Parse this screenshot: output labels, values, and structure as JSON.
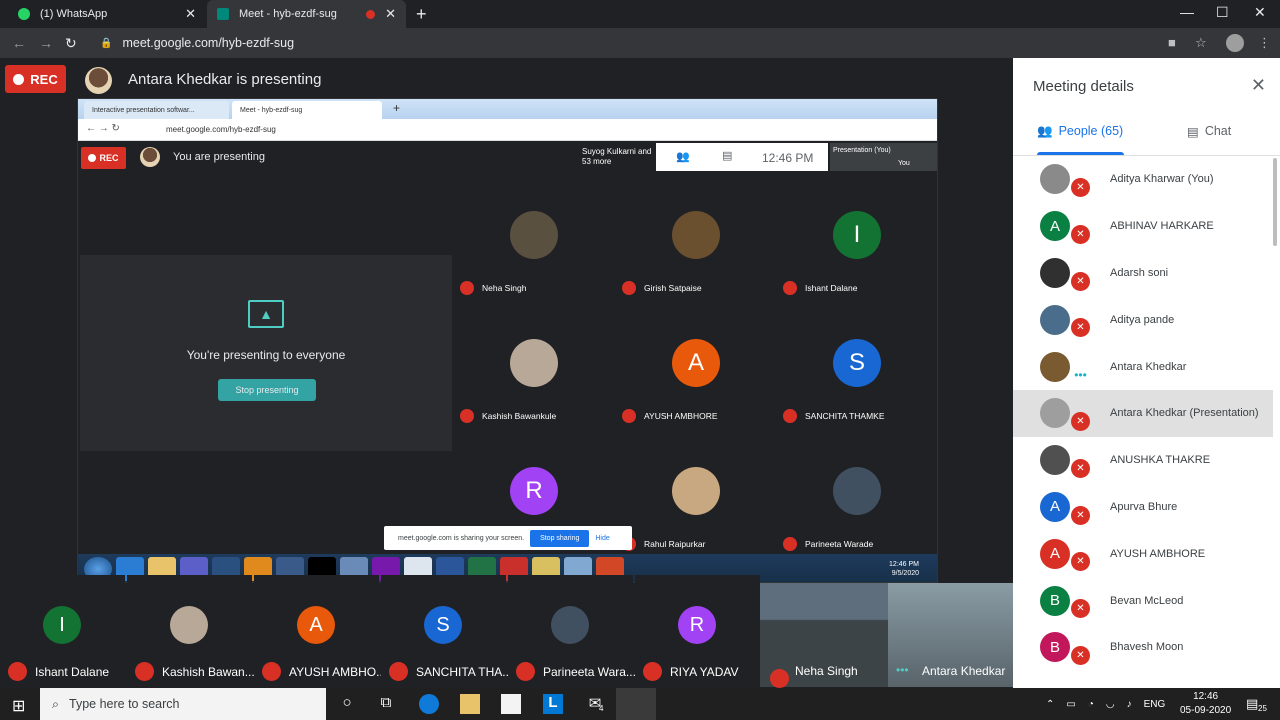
{
  "browser": {
    "tabs": [
      {
        "label": "(1) WhatsApp"
      },
      {
        "label": "Meet - hyb-ezdf-sug"
      }
    ],
    "url": "meet.google.com/hyb-ezdf-sug"
  },
  "meet": {
    "rec_label": "REC",
    "presenting_title": "Antara Khedkar is presenting"
  },
  "shared_screen": {
    "tabs": [
      "Interactive presentation softwar...",
      "Meet - hyb-ezdf-sug"
    ],
    "url": "meet.google.com/hyb-ezdf-sug",
    "rec_label": "REC",
    "title": "You are presenting",
    "top_people": "Suyog Kulkarni and 53 more",
    "time": "12:46 PM",
    "presentation_label": "Presentation (You)",
    "you_label": "You",
    "presenting_msg": "You're presenting to everyone",
    "stop_btn": "Stop presenting",
    "tiles": [
      {
        "name": "Neha Singh",
        "initial": "",
        "color": "#5a5040"
      },
      {
        "name": "Girish Satpaise",
        "initial": "",
        "color": "#6b5030"
      },
      {
        "name": "Ishant Dalane",
        "initial": "I",
        "color": "#137333"
      },
      {
        "name": "Kashish Bawankule",
        "initial": "",
        "color": "#b8a898"
      },
      {
        "name": "AYUSH AMBHORE",
        "initial": "A",
        "color": "#e8590c"
      },
      {
        "name": "SANCHITA THAMKE",
        "initial": "S",
        "color": "#1967d2"
      },
      {
        "name": "",
        "initial": "R",
        "color": "#a142f4"
      },
      {
        "name": "Rahul Raipurkar",
        "initial": "",
        "color": "#c8a880"
      },
      {
        "name": "Parineeta Warade",
        "initial": "",
        "color": "#405060"
      }
    ],
    "share_bar": {
      "text": "meet.google.com is sharing your screen.",
      "stop": "Stop sharing",
      "hide": "Hide"
    },
    "clock": {
      "time": "12:46 PM",
      "date": "9/5/2020"
    }
  },
  "filmstrip": [
    {
      "name": "Ishant Dalane",
      "initial": "I",
      "color": "#137333"
    },
    {
      "name": "Kashish Bawan...",
      "initial": "",
      "color": "#b8a898"
    },
    {
      "name": "AYUSH AMBHO...",
      "initial": "A",
      "color": "#e8590c"
    },
    {
      "name": "SANCHITA THA...",
      "initial": "S",
      "color": "#1967d2"
    },
    {
      "name": "Parineeta Wara...",
      "initial": "",
      "color": "#405060"
    },
    {
      "name": "RIYA YADAV",
      "initial": "R",
      "color": "#a142f4"
    }
  ],
  "videos": {
    "neha": "Neha Singh",
    "antara": "Antara Khedkar"
  },
  "panel": {
    "title": "Meeting details",
    "people_tab": "People (65)",
    "chat_tab": "Chat",
    "people": [
      {
        "name": "Aditya Kharwar (You)",
        "initial": "",
        "color": "#8a8a8a"
      },
      {
        "name": "ABHINAV HARKARE",
        "initial": "A",
        "color": "#0b8043"
      },
      {
        "name": "Adarsh soni",
        "initial": "",
        "color": "#303030"
      },
      {
        "name": "Aditya pande",
        "initial": "",
        "color": "#4a6d8c"
      },
      {
        "name": "Antara Khedkar",
        "initial": "",
        "color": "#7a5a30"
      },
      {
        "name": "Antara Khedkar (Presentation)",
        "initial": "",
        "color": "#9e9e9e"
      },
      {
        "name": "ANUSHKA THAKRE",
        "initial": "",
        "color": "#505050"
      },
      {
        "name": "Apurva Bhure",
        "initial": "A",
        "color": "#1967d2"
      },
      {
        "name": "AYUSH AMBHORE",
        "initial": "A",
        "color": "#d93025"
      },
      {
        "name": "Bevan McLeod",
        "initial": "B",
        "color": "#0b8043"
      },
      {
        "name": "Bhavesh Moon",
        "initial": "B",
        "color": "#c2185b"
      }
    ]
  },
  "taskbar": {
    "search_placeholder": "Type here to search",
    "lang": "ENG",
    "time": "12:46",
    "date": "05-09-2020",
    "notif_count": "25",
    "mail_badge": "4"
  }
}
